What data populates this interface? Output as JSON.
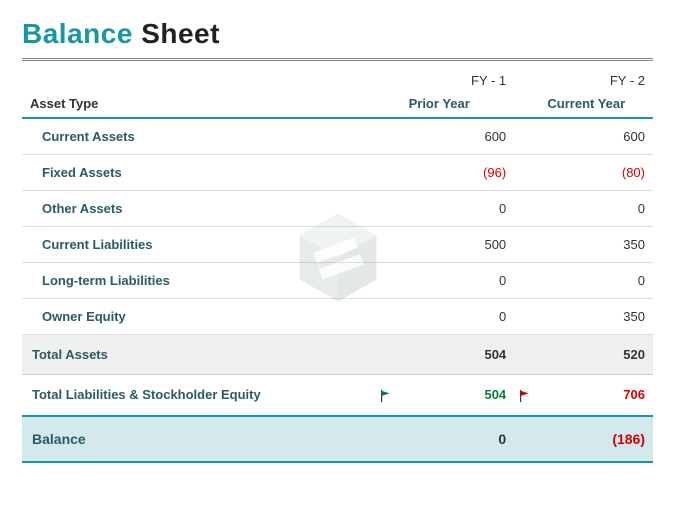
{
  "title": {
    "word1": "Balance",
    "word2": "Sheet"
  },
  "headers": {
    "fy1": "FY - 1",
    "fy2": "FY - 2",
    "asset_type": "Asset Type",
    "prior_year": "Prior Year",
    "current_year": "Current Year"
  },
  "rows": [
    {
      "label": "Current Assets",
      "fy1": "600",
      "fy2": "600",
      "neg1": false,
      "neg2": false
    },
    {
      "label": "Fixed Assets",
      "fy1": "(96)",
      "fy2": "(80)",
      "neg1": true,
      "neg2": true
    },
    {
      "label": "Other Assets",
      "fy1": "0",
      "fy2": "0",
      "neg1": false,
      "neg2": false
    },
    {
      "label": "Current Liabilities",
      "fy1": "500",
      "fy2": "350",
      "neg1": false,
      "neg2": false
    },
    {
      "label": "Long-term Liabilities",
      "fy1": "0",
      "fy2": "0",
      "neg1": false,
      "neg2": false
    },
    {
      "label": "Owner Equity",
      "fy1": "0",
      "fy2": "350",
      "neg1": false,
      "neg2": false
    }
  ],
  "totals": {
    "assets": {
      "label": "Total Assets",
      "fy1": "504",
      "fy2": "520"
    },
    "liab_eq": {
      "label": "Total Liabilities & Stockholder Equity",
      "fy1": "504",
      "fy2": "706",
      "flag1": "good",
      "flag2": "bad"
    },
    "balance": {
      "label": "Balance",
      "fy1": "0",
      "fy2": "(186)",
      "neg2": true
    }
  },
  "chart_data": {
    "type": "table",
    "title": "Balance Sheet",
    "columns": [
      "Asset Type",
      "FY - 1 (Prior Year)",
      "FY - 2 (Current Year)"
    ],
    "rows": [
      [
        "Current Assets",
        600,
        600
      ],
      [
        "Fixed Assets",
        -96,
        -80
      ],
      [
        "Other Assets",
        0,
        0
      ],
      [
        "Current Liabilities",
        500,
        350
      ],
      [
        "Long-term Liabilities",
        0,
        0
      ],
      [
        "Owner Equity",
        0,
        350
      ],
      [
        "Total Assets",
        504,
        520
      ],
      [
        "Total Liabilities & Stockholder Equity",
        504,
        706
      ],
      [
        "Balance",
        0,
        -186
      ]
    ]
  }
}
